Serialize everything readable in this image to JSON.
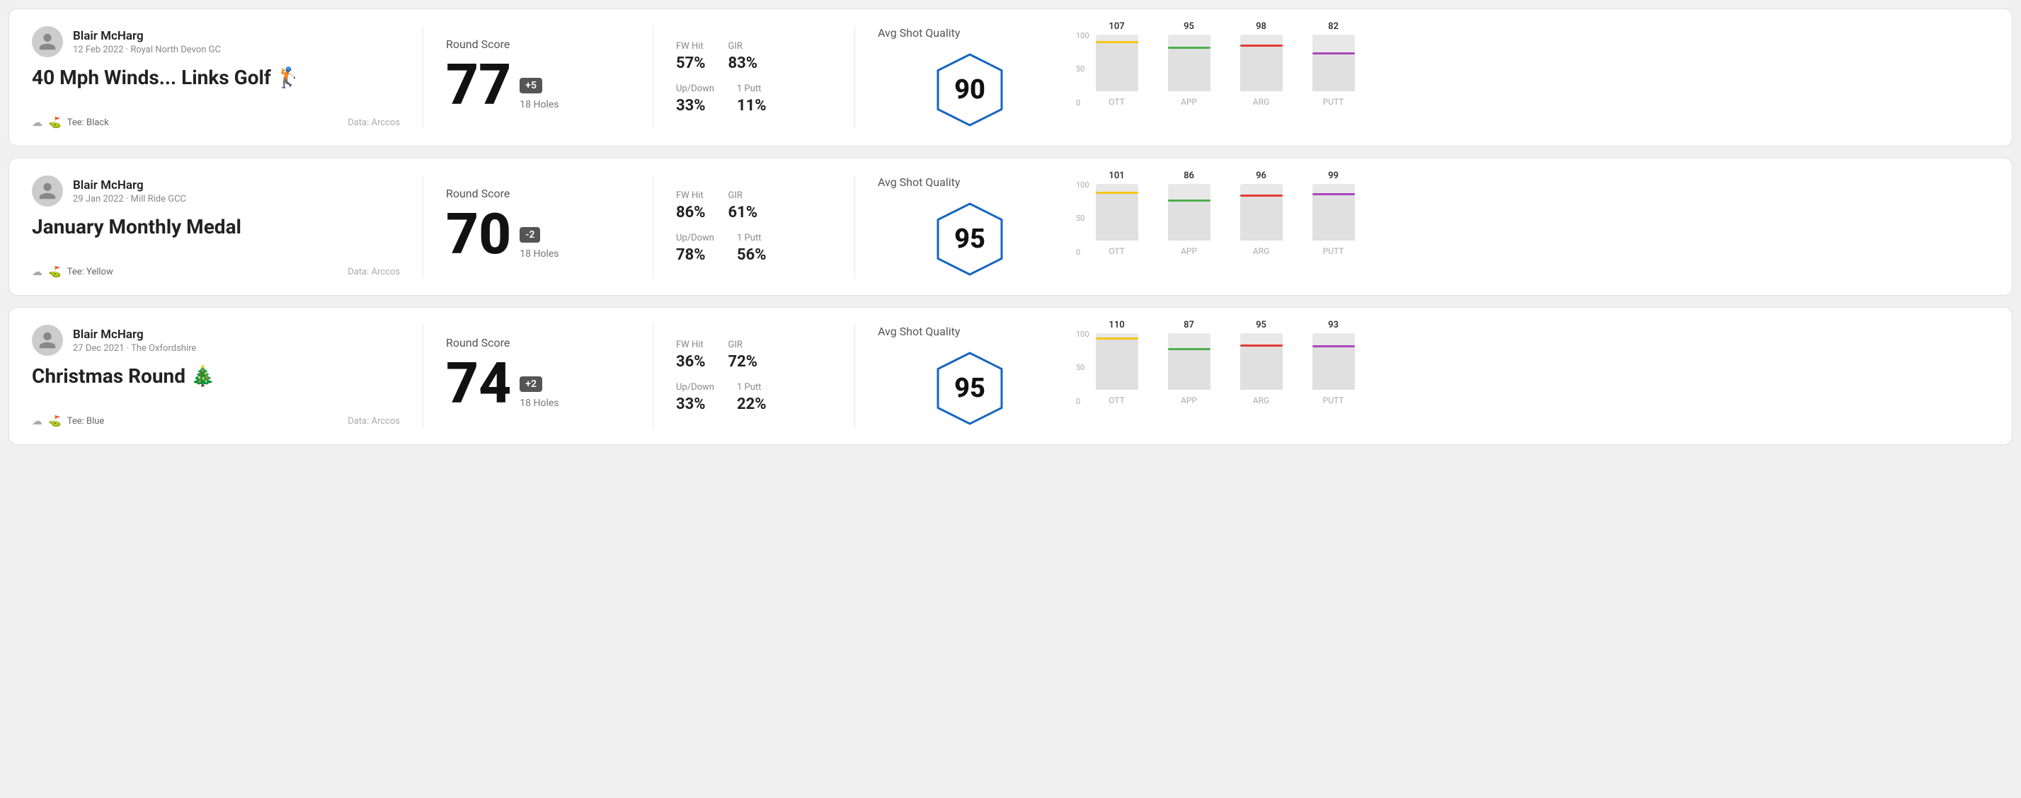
{
  "rounds": [
    {
      "id": "round-1",
      "user": {
        "name": "Blair McHarg",
        "meta": "12 Feb 2022 · Royal North Devon GC",
        "avatar": "person"
      },
      "title": "40 Mph Winds... Links Golf 🏌",
      "tee": "Black",
      "data_source": "Data: Arccos",
      "score": {
        "label": "Round Score",
        "number": "77",
        "badge": "+5",
        "holes": "18 Holes"
      },
      "stats": {
        "fw_hit_label": "FW Hit",
        "fw_hit_value": "57%",
        "gir_label": "GIR",
        "gir_value": "83%",
        "updown_label": "Up/Down",
        "updown_value": "33%",
        "oneputt_label": "1 Putt",
        "oneputt_value": "11%"
      },
      "quality": {
        "label": "Avg Shot Quality",
        "score": "90"
      },
      "chart": {
        "bars": [
          {
            "label": "OTT",
            "value": 107,
            "color": "#f5c518",
            "fill_pct": 85
          },
          {
            "label": "APP",
            "value": 95,
            "color": "#4caf50",
            "fill_pct": 75
          },
          {
            "label": "ARG",
            "value": 98,
            "color": "#e53935",
            "fill_pct": 78
          },
          {
            "label": "PUTT",
            "value": 82,
            "color": "#ab47bc",
            "fill_pct": 65
          }
        ]
      }
    },
    {
      "id": "round-2",
      "user": {
        "name": "Blair McHarg",
        "meta": "29 Jan 2022 · Mill Ride GCC",
        "avatar": "person"
      },
      "title": "January Monthly Medal",
      "tee": "Yellow",
      "data_source": "Data: Arccos",
      "score": {
        "label": "Round Score",
        "number": "70",
        "badge": "-2",
        "holes": "18 Holes"
      },
      "stats": {
        "fw_hit_label": "FW Hit",
        "fw_hit_value": "86%",
        "gir_label": "GIR",
        "gir_value": "61%",
        "updown_label": "Up/Down",
        "updown_value": "78%",
        "oneputt_label": "1 Putt",
        "oneputt_value": "56%"
      },
      "quality": {
        "label": "Avg Shot Quality",
        "score": "95"
      },
      "chart": {
        "bars": [
          {
            "label": "OTT",
            "value": 101,
            "color": "#f5c518",
            "fill_pct": 82
          },
          {
            "label": "APP",
            "value": 86,
            "color": "#4caf50",
            "fill_pct": 68
          },
          {
            "label": "ARG",
            "value": 96,
            "color": "#e53935",
            "fill_pct": 77
          },
          {
            "label": "PUTT",
            "value": 99,
            "color": "#ab47bc",
            "fill_pct": 80
          }
        ]
      }
    },
    {
      "id": "round-3",
      "user": {
        "name": "Blair McHarg",
        "meta": "27 Dec 2021 · The Oxfordshire",
        "avatar": "person"
      },
      "title": "Christmas Round 🎄",
      "tee": "Blue",
      "data_source": "Data: Arccos",
      "score": {
        "label": "Round Score",
        "number": "74",
        "badge": "+2",
        "holes": "18 Holes"
      },
      "stats": {
        "fw_hit_label": "FW Hit",
        "fw_hit_value": "36%",
        "gir_label": "GIR",
        "gir_value": "72%",
        "updown_label": "Up/Down",
        "updown_value": "33%",
        "oneputt_label": "1 Putt",
        "oneputt_value": "22%"
      },
      "quality": {
        "label": "Avg Shot Quality",
        "score": "95"
      },
      "chart": {
        "bars": [
          {
            "label": "OTT",
            "value": 110,
            "color": "#f5c518",
            "fill_pct": 88
          },
          {
            "label": "APP",
            "value": 87,
            "color": "#4caf50",
            "fill_pct": 70
          },
          {
            "label": "ARG",
            "value": 95,
            "color": "#e53935",
            "fill_pct": 76
          },
          {
            "label": "PUTT",
            "value": 93,
            "color": "#ab47bc",
            "fill_pct": 74
          }
        ]
      }
    }
  ],
  "y_axis": [
    "100",
    "50",
    "0"
  ]
}
